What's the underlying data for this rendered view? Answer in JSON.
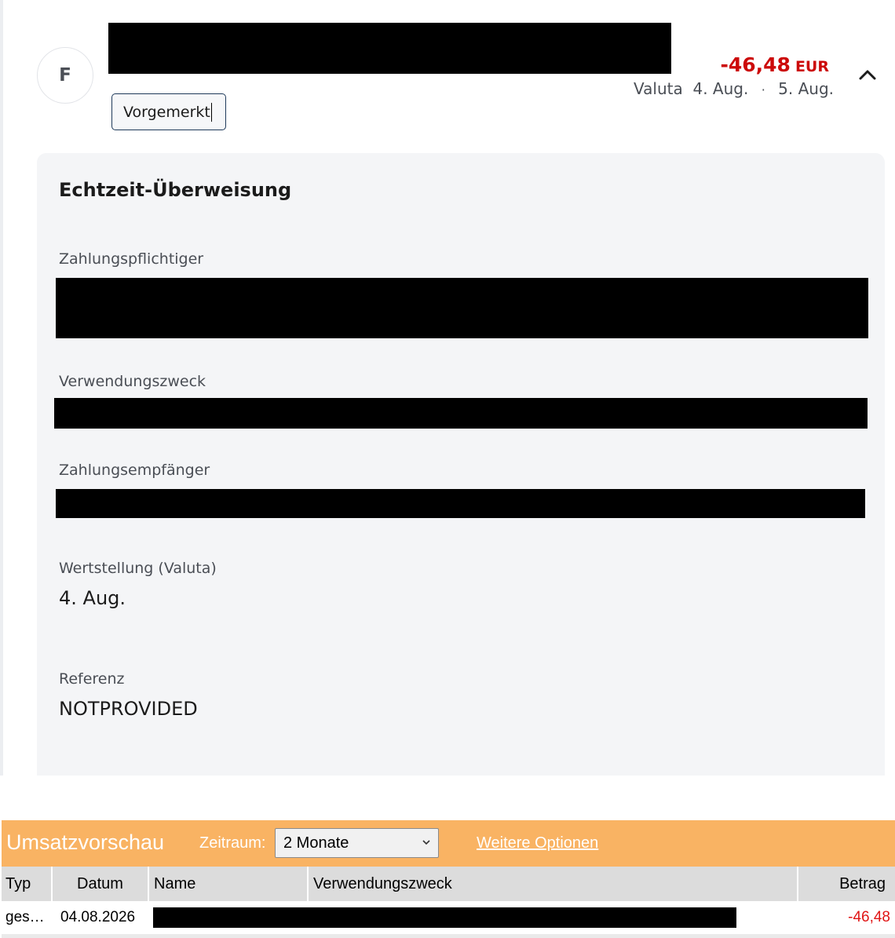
{
  "transaction": {
    "avatar_letter": "F",
    "status_badge": "Vorgemerkt",
    "amount": "-46,48",
    "currency": "EUR",
    "valuta_label": "Valuta",
    "valuta_date": "4. Aug.",
    "booking_date": "5. Aug.",
    "separator": "·",
    "colors": {
      "negative": "#cc0a0a"
    }
  },
  "details": {
    "title": "Echtzeit-Überweisung",
    "payer_label": "Zahlungspflichtiger",
    "purpose_label": "Verwendungszweck",
    "payee_label": "Zahlungsempfänger",
    "value_date_label": "Wertstellung (Valuta)",
    "value_date": "4. Aug.",
    "reference_label": "Referenz",
    "reference": "NOTPROVIDED"
  },
  "umsatzvorschau": {
    "title": "Umsatzvorschau",
    "zeitraum_label": "Zeitraum:",
    "zeitraum_value": "2 Monate",
    "more_options": "Weitere Optionen",
    "accent_color": "#f9b363",
    "table": {
      "headers": {
        "typ": "Typ",
        "datum": "Datum",
        "name": "Name",
        "verwendungszweck": "Verwendungszweck",
        "betrag": "Betrag"
      },
      "rows": [
        {
          "typ": "ges…",
          "datum": "04.08.2026",
          "betrag": "-46,48"
        }
      ]
    }
  }
}
